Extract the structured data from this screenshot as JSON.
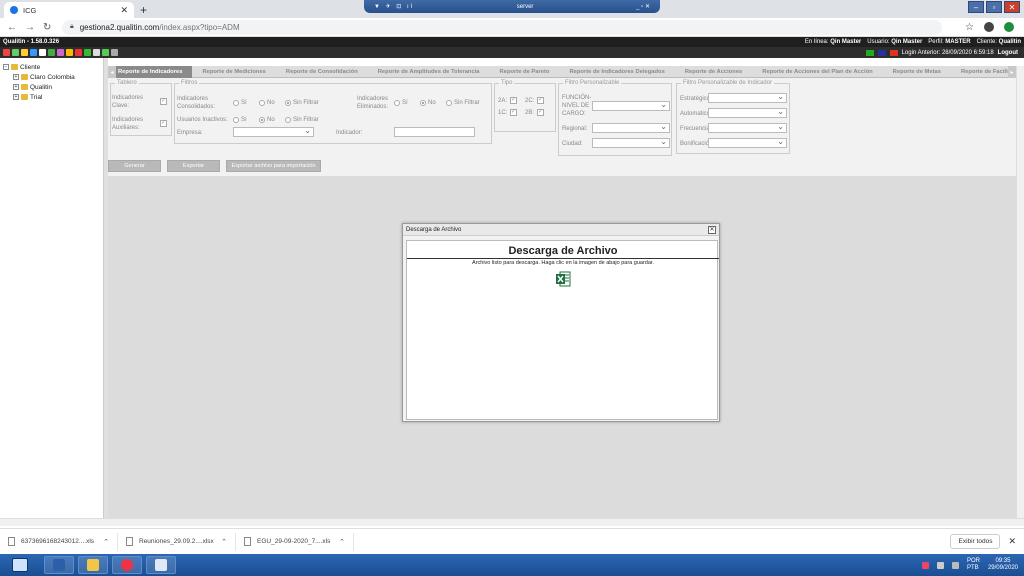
{
  "browser": {
    "tab_title": "ICG",
    "new_tab": "+",
    "url_host": "gestiona2.qualitin.com",
    "url_path": "/index.aspx?tipo=ADM",
    "rdp_title": "server"
  },
  "app": {
    "version": "Qualitin - 1.58.0.326",
    "online_label": "En línea:",
    "online_user": "Qin Master",
    "user_label": "Usuario:",
    "user_value": "Qin Master",
    "profile_label": "Perfil:",
    "profile_value": "MASTER",
    "client_label": "Cliente:",
    "client_value": "Qualitin",
    "last_login": "Login Anterior: 28/09/2020 6:59:18",
    "logout": "Logout"
  },
  "tree": {
    "root": "Cliente",
    "items": [
      "Claro Colombia",
      "Qualitin",
      "Trial"
    ]
  },
  "report_tabs": [
    "Reporte de Indicadores",
    "Reporte de Mediciones",
    "Reporte de Consolidación",
    "Reporte de Amplitudes de Tolerancia",
    "Reporte de Pareto",
    "Reporte de Indicadores Delegados",
    "Reporte de Acciones",
    "Reporte de Acciones del Plan de Acción",
    "Reporte de Metas",
    "Reporte de Facilit"
  ],
  "filters": {
    "tablero_legend": "Tablero",
    "ind_clave": "Indicadores Clave:",
    "ind_auxiliares": "Indicadores Auxiliares:",
    "filtros_legend": "Filtros",
    "ind_consolidados": "Indicadores Consolidados:",
    "usuarios_inactivos": "Usuarios Inactivos:",
    "ind_eliminados": "Indicadores Eliminados:",
    "empresa": "Empresa:",
    "indicador": "Indicador:",
    "si": "Sí",
    "no": "No",
    "sin_filtrar": "Sin Filtrar",
    "tipo_legend": "Tipo",
    "tipo_2a": "2A:",
    "tipo_2c": "2C:",
    "tipo_1c": "1C:",
    "tipo_2b": "2B:",
    "filtro_pers_legend": "Filtro Personalizable",
    "funcion": "FUNCIÓN-NIVEL DE CARGO:",
    "regional": "Regional:",
    "ciudad": "Ciudad:",
    "filtro_ind_legend": "Filtro Personalizable de Indicador",
    "estrategico": "Estratégico:",
    "automatico": "Automatico:",
    "frecuencia": "Frecuencia:",
    "bonificacion": "Bonificación:"
  },
  "buttons": {
    "generar": "Generar",
    "exportar": "Exportar",
    "exportar_importacion": "Exportar archivo para importación"
  },
  "dialog": {
    "header": "Descarga de Archivo",
    "close": "✕",
    "title": "Descarga de Archivo",
    "message": "Archivo listo para descarga. Haga clic en la imagen de abajo para guardar."
  },
  "downloads": {
    "items": [
      "637369616824301​2....xls",
      "Reuniones_29.09.2....xlsx",
      "EGU_29-09-2020_7....xls"
    ],
    "show_all": "Exibir todos"
  },
  "taskbar": {
    "lang_1": "POR",
    "lang_2": "PTB",
    "time": "09:35",
    "date": "29/09/2020"
  },
  "colors": {
    "active_tab": "#8a8a8a",
    "taskbar": "#2c67b3",
    "header_bg": "#1f1f1f"
  }
}
